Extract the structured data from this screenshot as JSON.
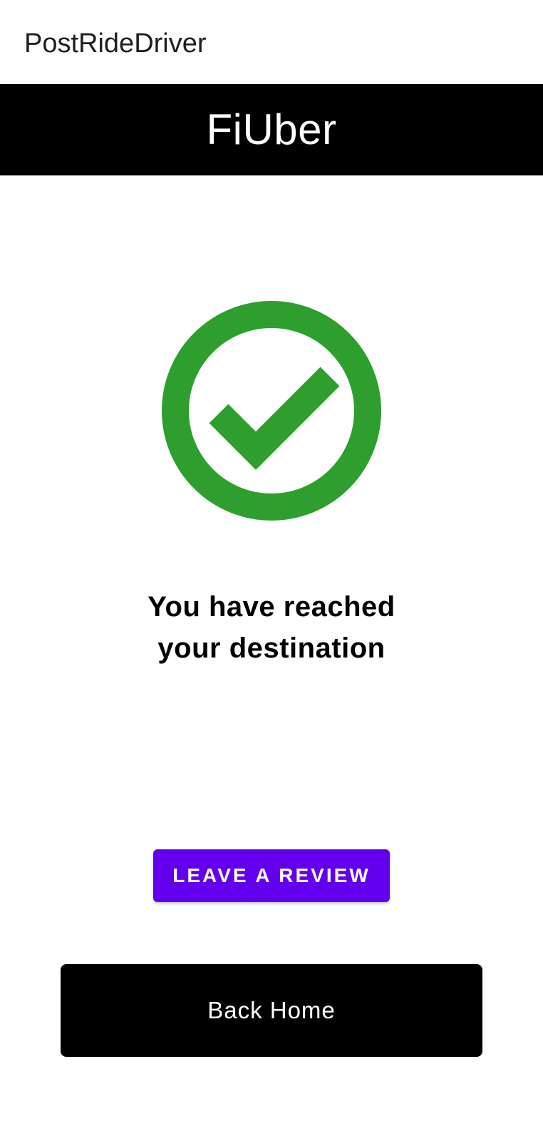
{
  "app_bar": {
    "title": "PostRideDriver"
  },
  "brand": {
    "title": "FiUber"
  },
  "status": {
    "icon": "check-circle-icon",
    "icon_color": "#2e9e2e",
    "message_line1": "You have reached",
    "message_line2": "your destination"
  },
  "actions": {
    "review_label": "LEAVE A REVIEW",
    "review_color": "#6200ee",
    "home_label": "Back Home",
    "home_color": "#000000"
  }
}
